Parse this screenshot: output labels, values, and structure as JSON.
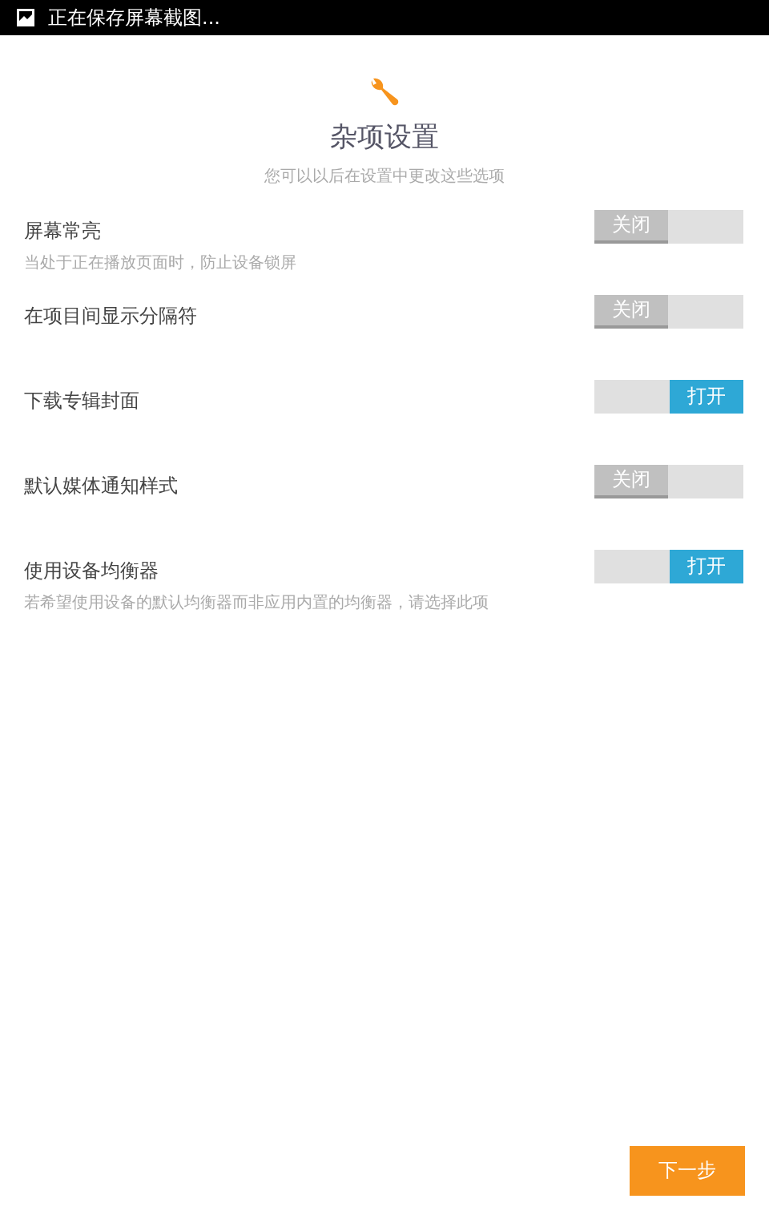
{
  "status_bar": {
    "notification": "正在保存屏幕截图..."
  },
  "header": {
    "title": "杂项设置",
    "subtitle": "您可以以后在设置中更改这些选项"
  },
  "settings": [
    {
      "label": "屏幕常亮",
      "description": "当处于正在播放页面时，防止设备锁屏",
      "on": false,
      "toggle_text": "关闭"
    },
    {
      "label": "在项目间显示分隔符",
      "on": false,
      "toggle_text": "关闭"
    },
    {
      "label": "下载专辑封面",
      "on": true,
      "toggle_text": "打开"
    },
    {
      "label": "默认媒体通知样式",
      "on": false,
      "toggle_text": "关闭"
    },
    {
      "label": "使用设备均衡器",
      "description": "若希望使用设备的默认均衡器而非应用内置的均衡器，请选择此项",
      "on": true,
      "toggle_text": "打开"
    }
  ],
  "next_button": {
    "label": "下一步"
  }
}
